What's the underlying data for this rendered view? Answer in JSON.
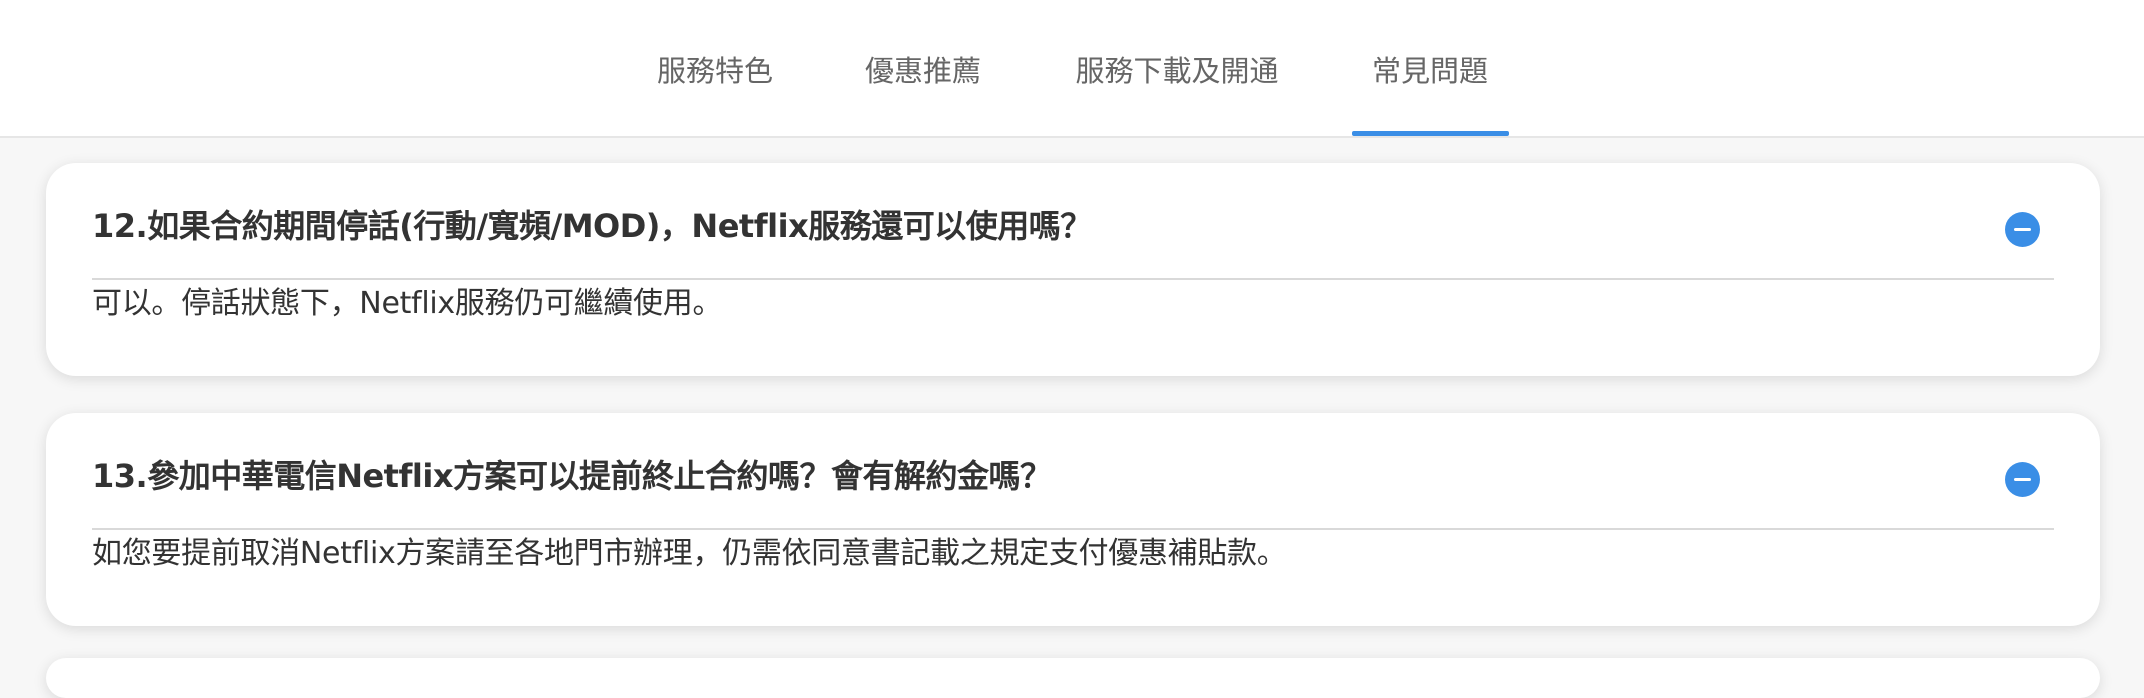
{
  "nav": {
    "tabs": [
      {
        "label": "服務特色"
      },
      {
        "label": "優惠推薦"
      },
      {
        "label": "服務下載及開通"
      },
      {
        "label": "常見問題"
      }
    ],
    "active_tab": "常見問題",
    "accent_color": "#3a8ee6"
  },
  "faq": [
    {
      "question": "12.如果合約期間停話(行動/寬頻/MOD)，Netflix服務還可以使用嗎？",
      "answer": "可以。停話狀態下，Netflix服務仍可繼續使用。",
      "expanded": true,
      "toggle_icon": "minus-circle-icon"
    },
    {
      "question": "13.參加中華電信Netflix方案可以提前終止合約嗎？會有解約金嗎？",
      "answer": "如您要提前取消Netflix方案請至各地門市辦理，仍需依同意書記載之規定支付優惠補貼款。",
      "expanded": true,
      "toggle_icon": "minus-circle-icon"
    }
  ]
}
